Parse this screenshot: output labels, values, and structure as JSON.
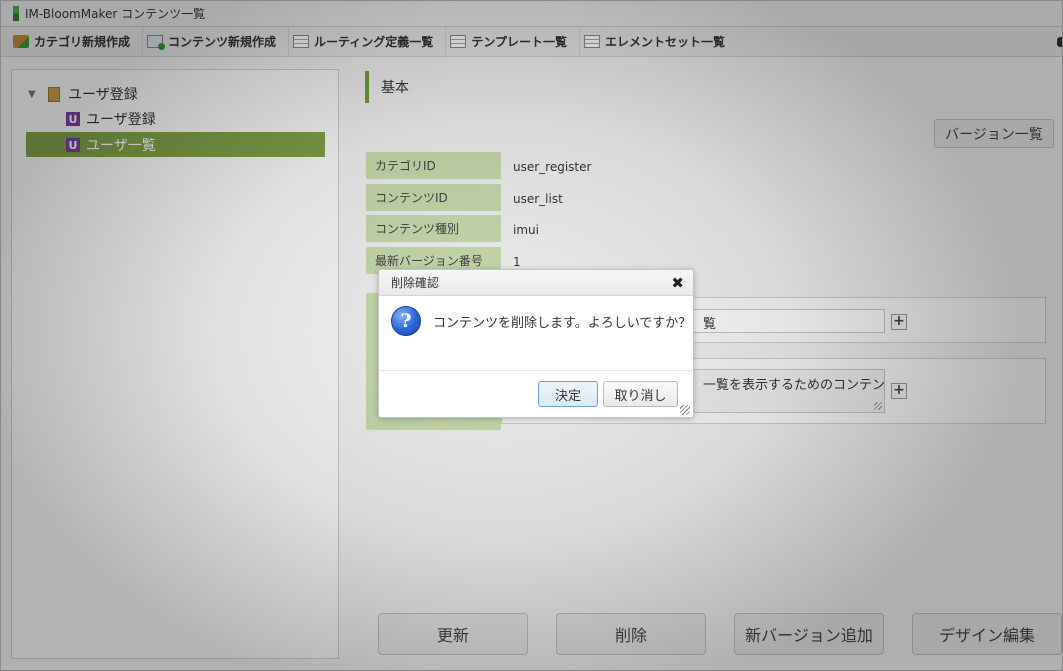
{
  "window": {
    "title": "IM-BloomMaker コンテンツ一覧"
  },
  "toolbar": {
    "items": [
      {
        "label": "カテゴリ新規作成",
        "icon": "category-add-icon"
      },
      {
        "label": "コンテンツ新規作成",
        "icon": "content-add-icon"
      },
      {
        "label": "ルーティング定義一覧",
        "icon": "list-icon"
      },
      {
        "label": "テンプレート一覧",
        "icon": "list-icon"
      },
      {
        "label": "エレメントセット一覧",
        "icon": "list-icon"
      }
    ]
  },
  "tree": {
    "root": {
      "label": "ユーザ登録",
      "icon": "folder-icon",
      "expanded": true
    },
    "children": [
      {
        "badge": "U",
        "label": "ユーザ登録",
        "selected": false
      },
      {
        "badge": "U",
        "label": "ユーザ一覧",
        "selected": true
      }
    ]
  },
  "section": {
    "title": "基本"
  },
  "version_button": "バージョン一覧",
  "info": {
    "rows": [
      {
        "label": "カテゴリID",
        "value": "user_register"
      },
      {
        "label": "コンテンツID",
        "value": "user_list"
      },
      {
        "label": "コンテンツ種別",
        "value": "imui"
      },
      {
        "label": "最新バージョン番号",
        "value": "1"
      }
    ]
  },
  "fields": {
    "name_value_partial": "覧",
    "description_value_partial": "一覧を表示するためのコンテン"
  },
  "bottom_buttons": {
    "update": "更新",
    "delete": "削除",
    "add_version": "新バージョン追加",
    "design_edit": "デザイン編集"
  },
  "dialog": {
    "title": "削除確認",
    "close": "✖",
    "icon": "question-icon",
    "message": "コンテンツを削除します。よろしいですか？",
    "ok": "決定",
    "cancel": "取り消し"
  },
  "colors": {
    "accent_green": "#7fa04a",
    "label_bg": "#c9dcae",
    "badge_purple": "#7b3fa0"
  }
}
